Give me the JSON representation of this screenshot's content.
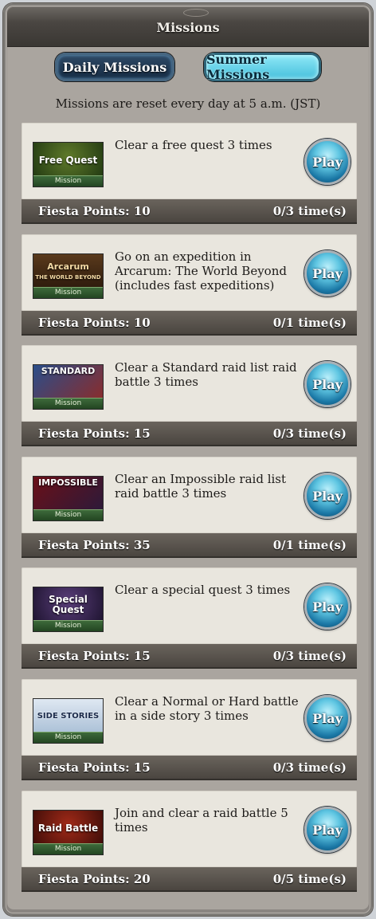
{
  "header": {
    "title": "Missions"
  },
  "tabs": [
    {
      "label": "Daily Missions",
      "active": false
    },
    {
      "label": "Summer Missions",
      "active": true
    }
  ],
  "reset_note": "Missions are reset every day at 5 a.m. (JST)",
  "play_label": "Play",
  "missions": [
    {
      "thumb_title": "Free Quest",
      "thumb_strip": "Mission",
      "icon": "free-quest-thumbnail",
      "description": "Clear a free quest 3 times",
      "points": "Fiesta Points: 10",
      "progress": "0/3 time(s)"
    },
    {
      "thumb_title": "Arcarum\nTHE WORLD BEYOND",
      "thumb_strip": "Mission",
      "icon": "arcarum-thumbnail",
      "description": "Go on an expedition in Arcarum: The World Beyond (includes fast expeditions)",
      "points": "Fiesta Points: 10",
      "progress": "0/1 time(s)"
    },
    {
      "thumb_title": "STANDARD",
      "thumb_strip": "Mission",
      "icon": "standard-raid-thumbnail",
      "description": "Clear a Standard raid list raid battle 3 times",
      "points": "Fiesta Points: 15",
      "progress": "0/3 time(s)"
    },
    {
      "thumb_title": "IMPOSSIBLE",
      "thumb_strip": "Mission",
      "icon": "impossible-raid-thumbnail",
      "description": "Clear an Impossible raid list raid battle 3 times",
      "points": "Fiesta Points: 35",
      "progress": "0/1 time(s)"
    },
    {
      "thumb_title": "Special Quest",
      "thumb_strip": "Mission",
      "icon": "special-quest-thumbnail",
      "description": "Clear a special quest 3 times",
      "points": "Fiesta Points: 15",
      "progress": "0/3 time(s)"
    },
    {
      "thumb_title": "SIDE STORIES",
      "thumb_strip": "Mission",
      "icon": "side-stories-thumbnail",
      "description": "Clear a Normal or Hard battle in a side story 3 times",
      "points": "Fiesta Points: 15",
      "progress": "0/3 time(s)"
    },
    {
      "thumb_title": "Raid Battle",
      "thumb_strip": "Mission",
      "icon": "raid-battle-thumbnail",
      "description": "Join and clear a raid battle 5 times",
      "points": "Fiesta Points: 20",
      "progress": "0/5 time(s)"
    }
  ]
}
